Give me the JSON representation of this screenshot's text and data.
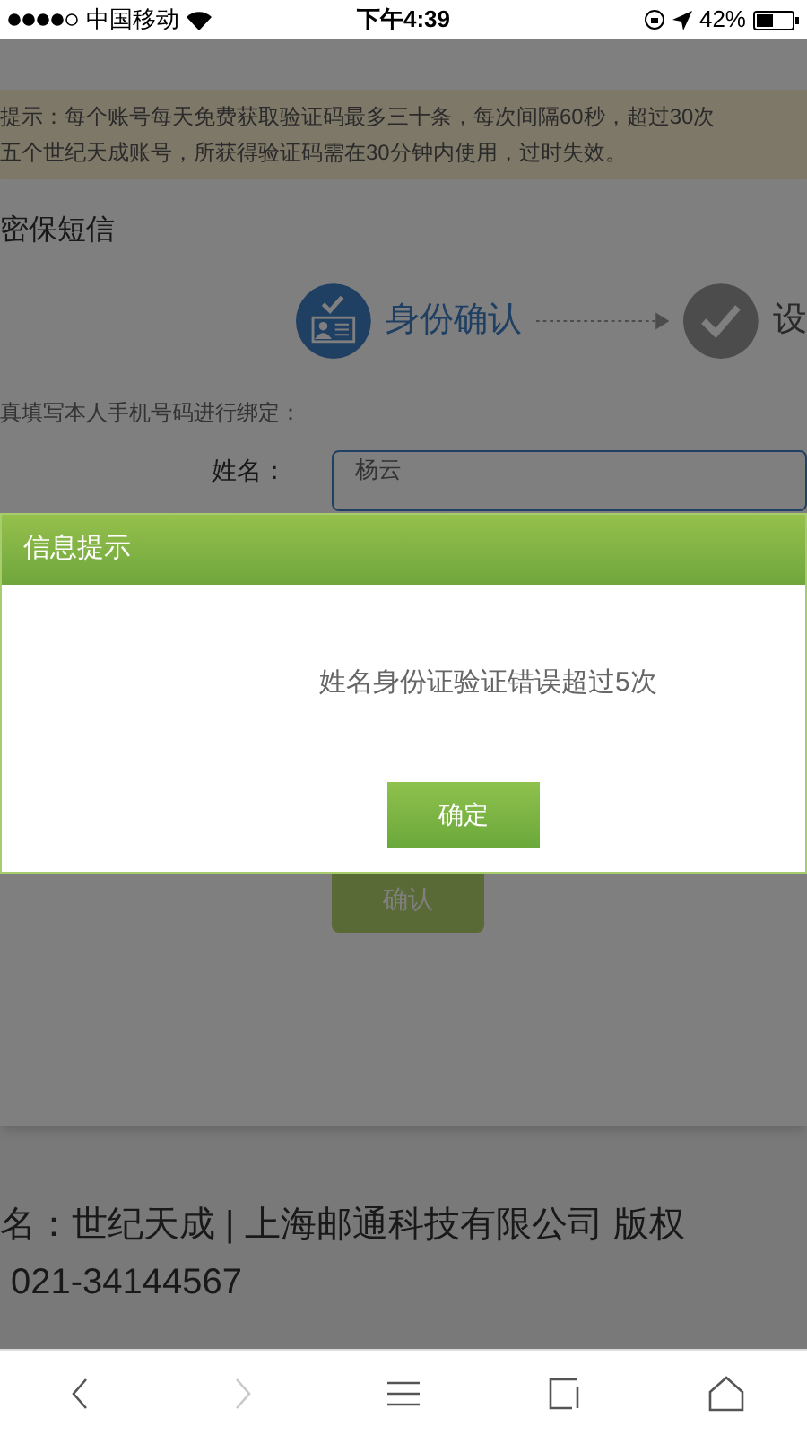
{
  "status_bar": {
    "carrier": "中国移动",
    "time": "下午4:39",
    "battery": "42%"
  },
  "notice": [
    "提示：每个账号每天免费获取验证码最多三十条，每次间隔60秒，超过30次",
    "五个世纪天成账号，所获得验证码需在30分钟内使用，过时失效。"
  ],
  "section_title": "密保短信",
  "steps": [
    {
      "label": "身份确认",
      "selected": true
    },
    {
      "label": "设",
      "selected": false
    }
  ],
  "instruction": "真填写本人手机号码进行绑定：",
  "form": {
    "name_label": "姓名：",
    "name_value": "杨云"
  },
  "confirm_button": "确认",
  "dialog": {
    "title": "信息提示",
    "message": "姓名身份证验证错误超过5次",
    "ok_button": "确定"
  },
  "footer": [
    "名：世纪天成 | 上海邮通科技有限公司 版权",
    "021-34144567"
  ],
  "toolbar": [
    {
      "kind": "back",
      "disabled": false
    },
    {
      "kind": "forward",
      "disabled": true
    },
    {
      "kind": "menu",
      "disabled": false
    },
    {
      "kind": "tabs",
      "disabled": false
    },
    {
      "kind": "home",
      "disabled": false
    }
  ]
}
